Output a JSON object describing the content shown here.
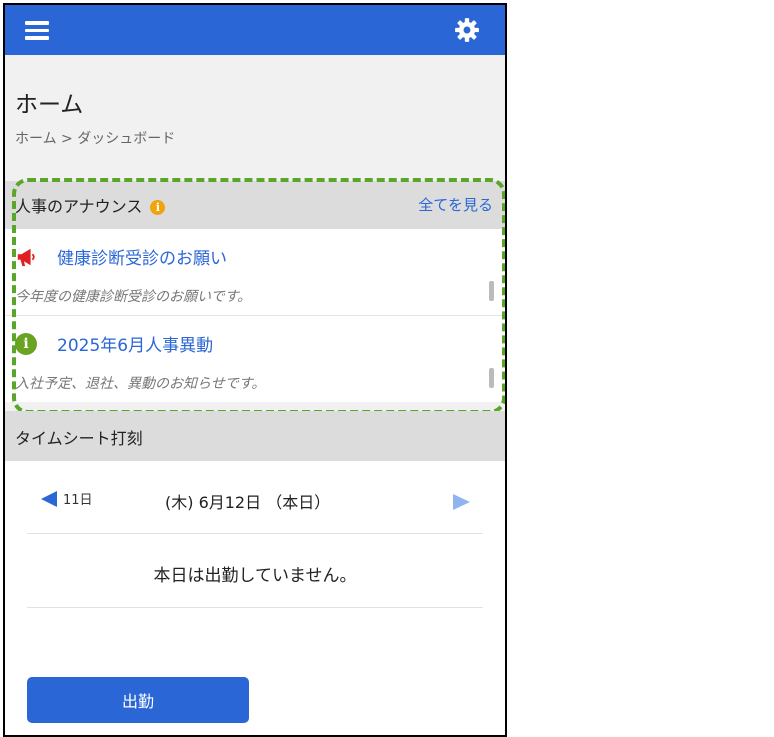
{
  "header": {
    "menu_icon": "hamburger-menu-icon",
    "settings_icon": "gear-icon",
    "bar_color": "#2a66d6"
  },
  "page": {
    "title": "ホーム",
    "breadcrumb": "ホーム > ダッシュボード"
  },
  "announcements": {
    "section_title": "人事のアナウンス",
    "info_icon": "info-icon",
    "see_all_label": "全てを見る",
    "items": [
      {
        "icon": "megaphone-icon",
        "icon_color": "#e02020",
        "title": "健康診断受診のお願い",
        "description": "今年度の健康診断受診のお願いです。"
      },
      {
        "icon": "info-circle-icon",
        "icon_color": "#6aa221",
        "title": "2025年6月人事異動",
        "description": "入社予定、退社、異動のお知らせです。"
      }
    ]
  },
  "timesheet": {
    "section_title": "タイムシート打刻",
    "prev_day_label": "11日",
    "current_date": "(木) 6月12日 （本日）",
    "status_message": "本日は出勤していません。",
    "clock_in_label": "出勤"
  },
  "colors": {
    "accent": "#2a66d6",
    "highlight_border": "#5ba52b",
    "info_badge": "#f0a30a"
  }
}
